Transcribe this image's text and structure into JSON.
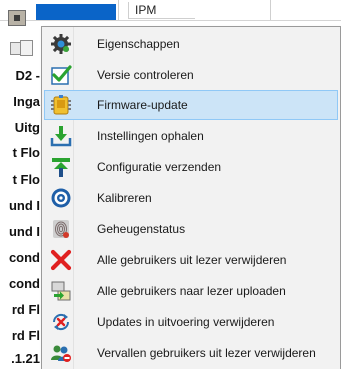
{
  "table": {
    "header_text": "IPM",
    "row_labels": [
      "D2 -",
      "Inga",
      "Uitg",
      "t Flo",
      "t Flo",
      "und I",
      "und I",
      "cond",
      "cond",
      "rd Fl",
      "rd Fl",
      ".1.21"
    ]
  },
  "context_menu": {
    "highlighted_index": 2,
    "items": [
      {
        "label": "Eigenschappen",
        "icon": "gear-icon"
      },
      {
        "label": "Versie controleren",
        "icon": "checkmark-icon"
      },
      {
        "label": "Firmware-update",
        "icon": "firmware-chip-icon"
      },
      {
        "label": "Instellingen ophalen",
        "icon": "download-tray-icon"
      },
      {
        "label": "Configuratie verzenden",
        "icon": "upload-arrow-icon"
      },
      {
        "label": "Kalibreren",
        "icon": "calibrate-target-icon"
      },
      {
        "label": "Geheugenstatus",
        "icon": "fingerprint-icon"
      },
      {
        "label": "Alle gebruikers uit lezer verwijderen",
        "icon": "red-x-icon"
      },
      {
        "label": "Alle gebruikers naar lezer uploaden",
        "icon": "transfer-icon"
      },
      {
        "label": "Updates in uitvoering verwijderen",
        "icon": "clear-sync-icon"
      },
      {
        "label": "Vervallen gebruikers uit lezer verwijderen",
        "icon": "users-remove-icon"
      }
    ]
  },
  "colors": {
    "selection_blue": "#0a64c8",
    "menu_highlight": "#cce4f7",
    "menu_highlight_border": "#90c8f6",
    "menu_background": "#f2f2f2"
  }
}
